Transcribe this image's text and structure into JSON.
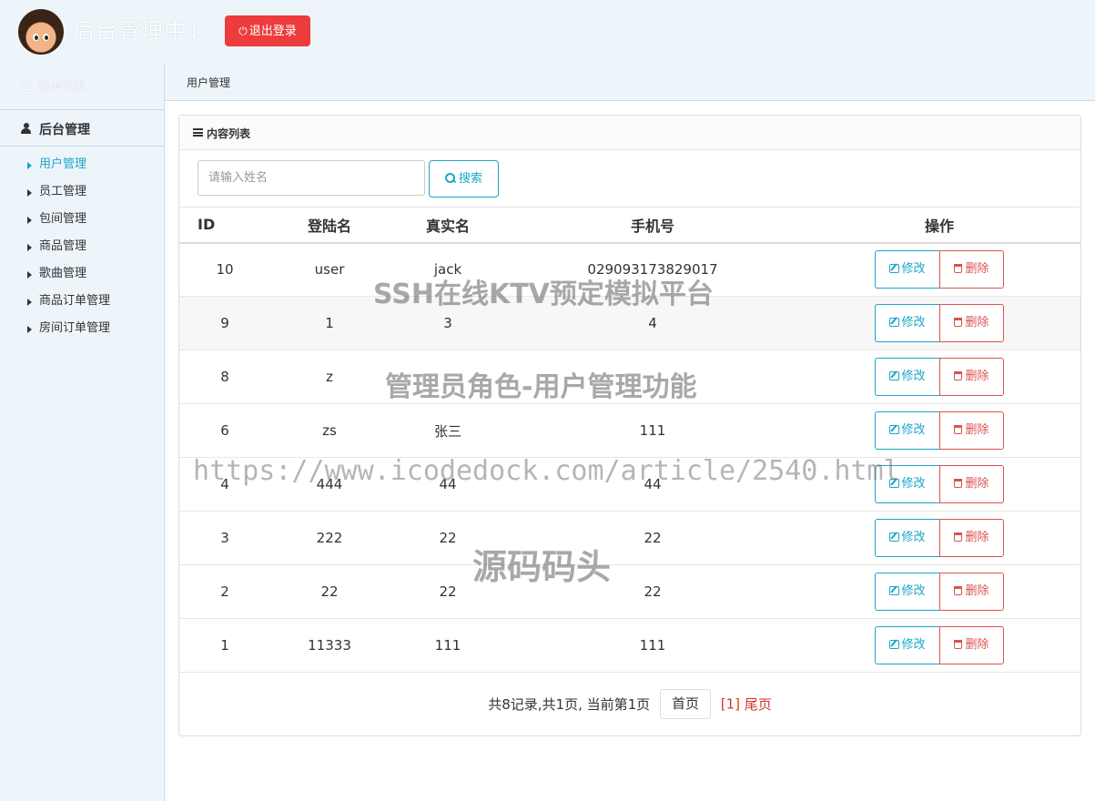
{
  "header": {
    "app_title": "后台管理中心",
    "logout_label": "退出登录"
  },
  "sidebar": {
    "menu_title": "菜单列表",
    "group_label": "后台管理",
    "items": [
      {
        "label": "用户管理",
        "active": true
      },
      {
        "label": "员工管理",
        "active": false
      },
      {
        "label": "包间管理",
        "active": false
      },
      {
        "label": "商品管理",
        "active": false
      },
      {
        "label": "歌曲管理",
        "active": false
      },
      {
        "label": "商品订单管理",
        "active": false
      },
      {
        "label": "房间订单管理",
        "active": false
      }
    ]
  },
  "breadcrumb": "用户管理",
  "panel": {
    "title": "内容列表",
    "search": {
      "placeholder": "请输入姓名",
      "value": "",
      "button_label": "搜索"
    }
  },
  "table": {
    "headers": [
      "ID",
      "登陆名",
      "真实名",
      "手机号",
      "操作"
    ],
    "edit_label": "修改",
    "delete_label": "删除",
    "rows": [
      {
        "id": "10",
        "login": "user",
        "real": "jack",
        "phone": "029093173829017"
      },
      {
        "id": "9",
        "login": "1",
        "real": "3",
        "phone": "4"
      },
      {
        "id": "8",
        "login": "z",
        "real": "",
        "phone": ""
      },
      {
        "id": "6",
        "login": "zs",
        "real": "张三",
        "phone": "111"
      },
      {
        "id": "4",
        "login": "444",
        "real": "44",
        "phone": "44"
      },
      {
        "id": "3",
        "login": "222",
        "real": "22",
        "phone": "22"
      },
      {
        "id": "2",
        "login": "22",
        "real": "22",
        "phone": "22"
      },
      {
        "id": "1",
        "login": "11333",
        "real": "111",
        "phone": "111"
      }
    ]
  },
  "pager": {
    "info": "共8记录,共1页, 当前第1页",
    "first_label": "首页",
    "current_label": "[1]",
    "last_label": "尾页"
  },
  "watermarks": [
    "SSH在线KTV预定模拟平台",
    "管理员角色-用户管理功能",
    "https://www.icodedock.com/article/2540.html",
    "源码码头"
  ],
  "colors": {
    "accent": "#1aa5c9",
    "danger": "#ed3c3c",
    "sidebar_bg": "#eef5fa"
  }
}
